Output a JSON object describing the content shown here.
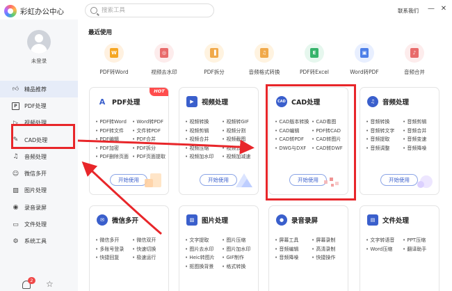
{
  "app": {
    "title": "彩虹办公中心",
    "contact": "联系我们"
  },
  "search": {
    "placeholder": "搜索工具"
  },
  "user": {
    "login_text": "未登录"
  },
  "nav": [
    {
      "label": "精品推荐",
      "icon": "thumbs-up-icon"
    },
    {
      "label": "PDF处理",
      "icon": "pdf-icon"
    },
    {
      "label": "视频处理",
      "icon": "video-icon"
    },
    {
      "label": "CAD处理",
      "icon": "cad-icon"
    },
    {
      "label": "音频处理",
      "icon": "music-icon"
    },
    {
      "label": "微信多开",
      "icon": "wechat-icon"
    },
    {
      "label": "图片处理",
      "icon": "image-icon"
    },
    {
      "label": "录音录屏",
      "icon": "record-icon"
    },
    {
      "label": "文件处理",
      "icon": "folder-icon"
    },
    {
      "label": "系统工具",
      "icon": "tools-icon"
    }
  ],
  "notifications": {
    "count": "2"
  },
  "recent": {
    "title": "最近使用",
    "items": [
      {
        "label": "PDF转Word",
        "glyph": "W",
        "bg": "#fff1e0",
        "fg": "#f5a623"
      },
      {
        "label": "视频去水印",
        "glyph": "◎",
        "bg": "#fdecec",
        "fg": "#e86b6b"
      },
      {
        "label": "PDF拆分",
        "glyph": "▐",
        "bg": "#fff3e0",
        "fg": "#f0a94a"
      },
      {
        "label": "音频格式转换",
        "glyph": "♫",
        "bg": "#fff3e0",
        "fg": "#f0a94a"
      },
      {
        "label": "PDF转Excel",
        "glyph": "E",
        "bg": "#e6f7ee",
        "fg": "#36b36b"
      },
      {
        "label": "Word转PDF",
        "glyph": "▣",
        "bg": "#e8efff",
        "fg": "#4d7fe8"
      },
      {
        "label": "音频合并",
        "glyph": "♪",
        "bg": "#fdecec",
        "fg": "#e86b6b"
      }
    ]
  },
  "cards": [
    {
      "title": "PDF处理",
      "icon_glyph": "A",
      "color": "#3a5fcc",
      "hot": "HOT",
      "items": [
        "PDF转Word",
        "Word转PDF",
        "PDF转文件",
        "文件转PDF",
        "PDF编辑",
        "PDF合并",
        "PDF加密",
        "PDF拆分",
        "PDF删除页面",
        "PDF页面提取"
      ],
      "button": "开始使用"
    },
    {
      "title": "视频处理",
      "icon_glyph": "▶",
      "color": "#3a5fcc",
      "items": [
        "视频转换",
        "视频转GIF",
        "视频剪辑",
        "视频分割",
        "视频合并",
        "视频截图",
        "视频压缩",
        "视频去水印",
        "视频加水印",
        "视频加减速"
      ],
      "button": "开始使用"
    },
    {
      "title": "CAD处理",
      "icon_glyph": "CAD",
      "color": "#3a5fcc",
      "items": [
        "CAD版本转换",
        "CAD看图",
        "CAD编辑",
        "PDF转CAD",
        "CAD转PDF",
        "CAD转图片",
        "DWG与DXF",
        "CAD转DWF"
      ],
      "button": "开始使用"
    },
    {
      "title": "音频处理",
      "icon_glyph": "♫",
      "color": "#3a5fcc",
      "items": [
        "音频转换",
        "音频剪辑",
        "音频转文字",
        "音频合并",
        "音频提取",
        "音频变速",
        "音频调整",
        "音频降噪"
      ],
      "button": "开始使用"
    },
    {
      "title": "微信多开",
      "icon_glyph": "✉",
      "color": "#3a5fcc",
      "items": [
        "微信多开",
        "微信双开",
        "多账号登录",
        "快速切换",
        "快捷回复",
        "极速运行"
      ]
    },
    {
      "title": "图片处理",
      "icon_glyph": "▨",
      "color": "#3a5fcc",
      "items": [
        "文字提取",
        "图片压缩",
        "图片去水印",
        "图片加水印",
        "Heic转图片",
        "GIF制作",
        "抠图换背景",
        "格式转换"
      ]
    },
    {
      "title": "录音录屏",
      "icon_glyph": "●",
      "color": "#3a5fcc",
      "items": [
        "屏幕工具",
        "屏幕录制",
        "音频编辑",
        "高清录制",
        "音频降噪",
        "快捷操作"
      ]
    },
    {
      "title": "文件处理",
      "icon_glyph": "▤",
      "color": "#3a5fcc",
      "items": [
        "文字转语音",
        "PPT压缩",
        "Word压缩",
        "翻译助手"
      ]
    }
  ]
}
